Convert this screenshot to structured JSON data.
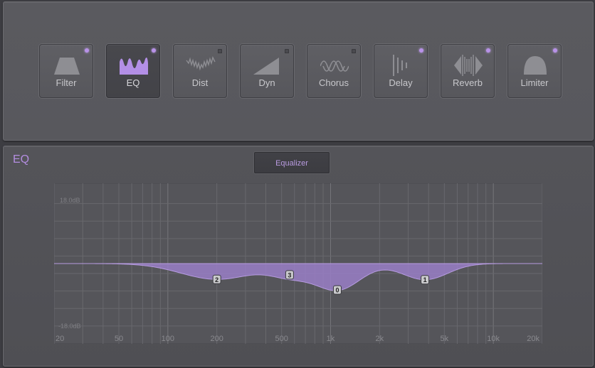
{
  "effects": [
    {
      "id": "filter",
      "label": "Filter",
      "icon": "filter-shape-icon",
      "active": false,
      "led": true
    },
    {
      "id": "eq",
      "label": "EQ",
      "icon": "eq-shape-icon",
      "active": true,
      "led": true
    },
    {
      "id": "dist",
      "label": "Dist",
      "icon": "distortion-wave-icon",
      "active": false,
      "led": false
    },
    {
      "id": "dyn",
      "label": "Dyn",
      "icon": "dynamics-ramp-icon",
      "active": false,
      "led": false
    },
    {
      "id": "chorus",
      "label": "Chorus",
      "icon": "chorus-wave-icon",
      "active": false,
      "led": false
    },
    {
      "id": "delay",
      "label": "Delay",
      "icon": "delay-lines-icon",
      "active": false,
      "led": true
    },
    {
      "id": "reverb",
      "label": "Reverb",
      "icon": "reverb-diamond-icon",
      "active": false,
      "led": true
    },
    {
      "id": "limiter",
      "label": "Limiter",
      "icon": "limiter-dome-icon",
      "active": false,
      "led": true
    }
  ],
  "section": {
    "title": "EQ",
    "tab_label": "Equalizer"
  },
  "graph": {
    "db_top": "18.0dB",
    "db_bottom": "-18.0dB",
    "freq_labels": [
      "20",
      "50",
      "100",
      "200",
      "500",
      "1k",
      "2k",
      "5k",
      "10k",
      "20k"
    ],
    "bands": [
      {
        "label": "2",
        "freq_hz": 200,
        "gain_db": -4.5
      },
      {
        "label": "3",
        "freq_hz": 560,
        "gain_db": -3.2
      },
      {
        "label": "0",
        "freq_hz": 1100,
        "gain_db": -7.5
      },
      {
        "label": "1",
        "freq_hz": 3800,
        "gain_db": -4.6
      }
    ]
  },
  "colors": {
    "accent": "#b892e8",
    "curve_fill": "#9a7fc7"
  }
}
